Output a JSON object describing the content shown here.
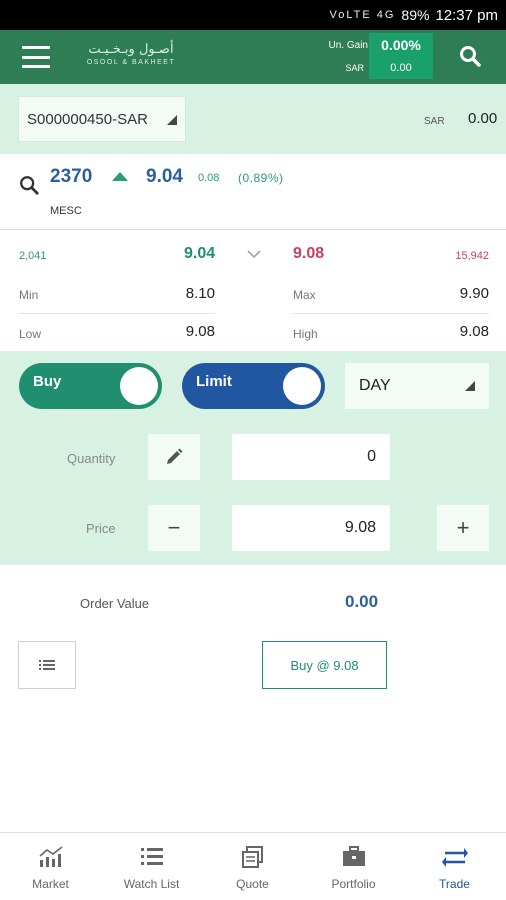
{
  "status_bar": {
    "battery": "89%",
    "time": "12:37 pm",
    "icons": "VoLTE 4G"
  },
  "header": {
    "logo_ar": "أصـول وبـخـيـت",
    "logo_en": "OSOOL & BAKHEET",
    "gain_label": "Un. Gain",
    "gain_value": "0.00%",
    "gain_currency_label": "SAR",
    "gain_amount": "0.00",
    "accent_color": "#2e7d55",
    "gain_box_color": "#1aa06b"
  },
  "account": {
    "selected": "S000000450-SAR",
    "currency": "SAR",
    "balance": "0.00"
  },
  "symbol": {
    "code": "2370",
    "price": "9.04",
    "change": "0.08",
    "change_pct": "(0.89%)",
    "name": "MESC",
    "direction": "up"
  },
  "quote": {
    "bid_size": "2,041",
    "bid_price": "9.04",
    "ask_price": "9.08",
    "ask_size": "15,942",
    "min_label": "Min",
    "min_value": "8.10",
    "max_label": "Max",
    "max_value": "9.90",
    "low_label": "Low",
    "low_value": "9.08",
    "high_label": "High",
    "high_value": "9.08"
  },
  "order": {
    "side_label": "Buy",
    "type_label": "Limit",
    "tif": "DAY",
    "quantity_label": "Quantity",
    "quantity_value": "0",
    "price_label": "Price",
    "price_value": "9.08",
    "minus_label": "−",
    "plus_label": "+",
    "order_value_label": "Order Value",
    "order_value": "0.00",
    "submit_label": "Buy @ 9.08",
    "buy_color": "#1f8f6f",
    "limit_color": "#2157a0"
  },
  "bottom_nav": [
    {
      "label": "Market",
      "icon": "market-chart-icon"
    },
    {
      "label": "Watch List",
      "icon": "list-icon"
    },
    {
      "label": "Quote",
      "icon": "quote-icon"
    },
    {
      "label": "Portfolio",
      "icon": "briefcase-icon"
    },
    {
      "label": "Trade",
      "icon": "trade-arrows-icon",
      "active": true
    }
  ]
}
